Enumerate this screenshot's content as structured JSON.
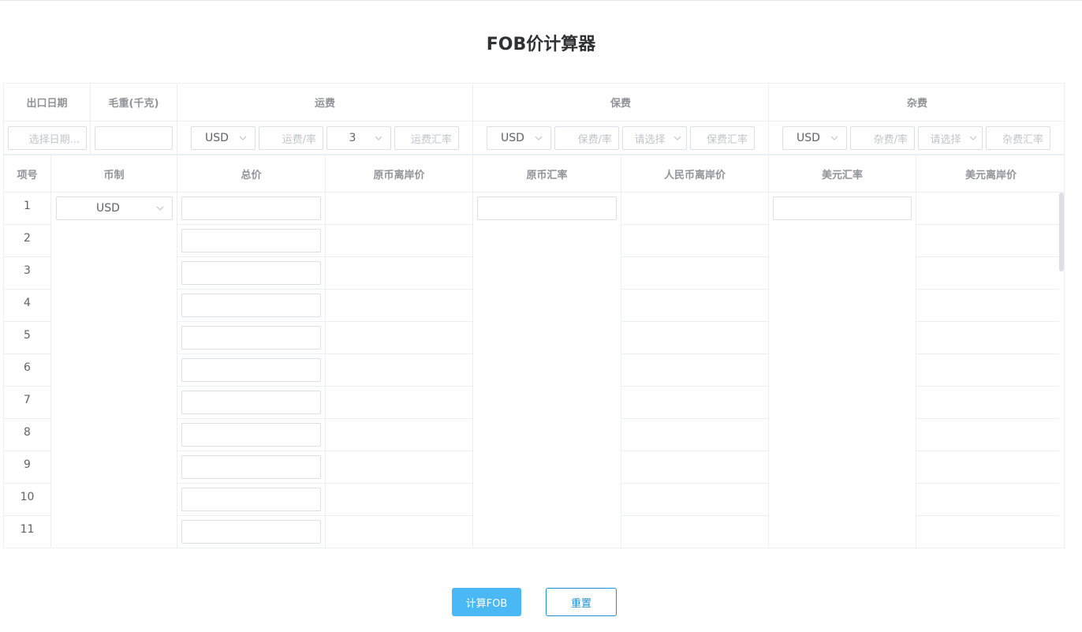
{
  "title": "FOB价计算器",
  "header_top": {
    "export_date": "出口日期",
    "gross_weight": "毛重(千克)",
    "freight": "运费",
    "insurance": "保费",
    "misc": "杂费"
  },
  "filters": {
    "date_placeholder": "选择日期...",
    "freight": {
      "currency": "USD",
      "amount_placeholder": "运费/率",
      "mode": "3",
      "rate_placeholder": "运费汇率"
    },
    "insurance": {
      "currency": "USD",
      "amount_placeholder": "保费/率",
      "mode_placeholder": "请选择",
      "rate_placeholder": "保费汇率"
    },
    "misc": {
      "currency": "USD",
      "amount_placeholder": "杂费/率",
      "mode_placeholder": "请选择",
      "rate_placeholder": "杂费汇率"
    }
  },
  "columns": [
    "项号",
    "币制",
    "总价",
    "原币离岸价",
    "原币汇率",
    "人民币离岸价",
    "美元汇率",
    "美元离岸价"
  ],
  "currency_value": "USD",
  "rows": [
    "1",
    "2",
    "3",
    "4",
    "5",
    "6",
    "7",
    "8",
    "9",
    "10",
    "11"
  ],
  "buttons": {
    "calculate": "计算FOB",
    "reset": "重置"
  },
  "icons": {
    "select_arrow": "chevron-down-icon"
  },
  "colors": {
    "primary": "#49b8f5",
    "border": "#ebeef5",
    "reset_text": "#1e8fcf"
  }
}
